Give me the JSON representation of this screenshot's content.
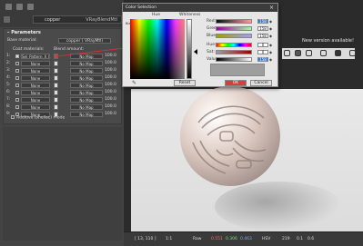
{
  "material_panel": {
    "material_name": "copper",
    "material_type": "VRayBlendMtl",
    "section_title": "Parameters",
    "base_material_label": "Base material:",
    "base_material_value": "copper  ( VRayMtl)",
    "coat_header": "Coat materials:",
    "blend_header": "Blend amount:",
    "coats": [
      {
        "index": "1:",
        "coat": "Sel_Pattern_X_Jong_X",
        "map": "No Map",
        "amount": "100.0"
      },
      {
        "index": "2:",
        "coat": "None",
        "map": "No Map",
        "amount": "100.0"
      },
      {
        "index": "3:",
        "coat": "None",
        "map": "No Map",
        "amount": "100.0"
      },
      {
        "index": "4:",
        "coat": "None",
        "map": "No Map",
        "amount": "100.0"
      },
      {
        "index": "5:",
        "coat": "None",
        "map": "No Map",
        "amount": "100.0"
      },
      {
        "index": "6:",
        "coat": "None",
        "map": "No Map",
        "amount": "100.0"
      },
      {
        "index": "7:",
        "coat": "None",
        "map": "No Map",
        "amount": "100.0"
      },
      {
        "index": "8:",
        "coat": "None",
        "map": "No Map",
        "amount": "100.0"
      },
      {
        "index": "9:",
        "coat": "None",
        "map": "No Map",
        "amount": "100.0"
      }
    ],
    "additive_label": "Additive (shellac) mode"
  },
  "color_dialog": {
    "title": "Color Selection",
    "hue_label": "Hue",
    "whiteness_label": "Whiteness",
    "blackness_label": "Blackness",
    "channels": [
      {
        "label": "Red:",
        "value": "158",
        "selected": true
      },
      {
        "label": "Green:",
        "value": "158",
        "selected": false
      },
      {
        "label": "Blue:",
        "value": "158",
        "selected": false
      },
      {
        "label": "Hue:",
        "value": "0",
        "selected": false
      },
      {
        "label": "Sat:",
        "value": "0",
        "selected": false
      },
      {
        "label": "Value:",
        "value": "158",
        "selected": true
      }
    ],
    "reset_label": "Reset",
    "ok_label": "OK",
    "cancel_label": "Cancel",
    "current_color": "#9e9e9e"
  },
  "viewport": {
    "new_version": "New version available!"
  },
  "statusbar": {
    "coords": "[ 13, 110 ]",
    "zoom": "1:1",
    "channel": "Raw",
    "r": "0.551",
    "g": "0.306",
    "b": "0.463",
    "mode": "HSV",
    "h": "219",
    "s": "0.1",
    "v": "0.6"
  }
}
